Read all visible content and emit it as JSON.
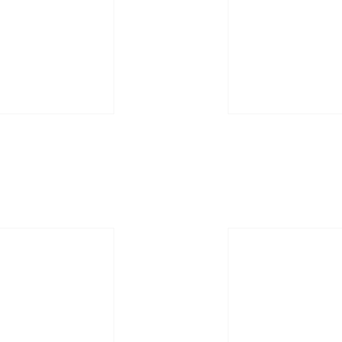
{
  "grid": {
    "tiles": [
      {
        "label": ""
      },
      {
        "label": ""
      },
      {
        "label": ""
      },
      {
        "label": ""
      }
    ]
  },
  "colors": {
    "background": "#ffffff",
    "tile_outline": "#f4f4f4"
  }
}
